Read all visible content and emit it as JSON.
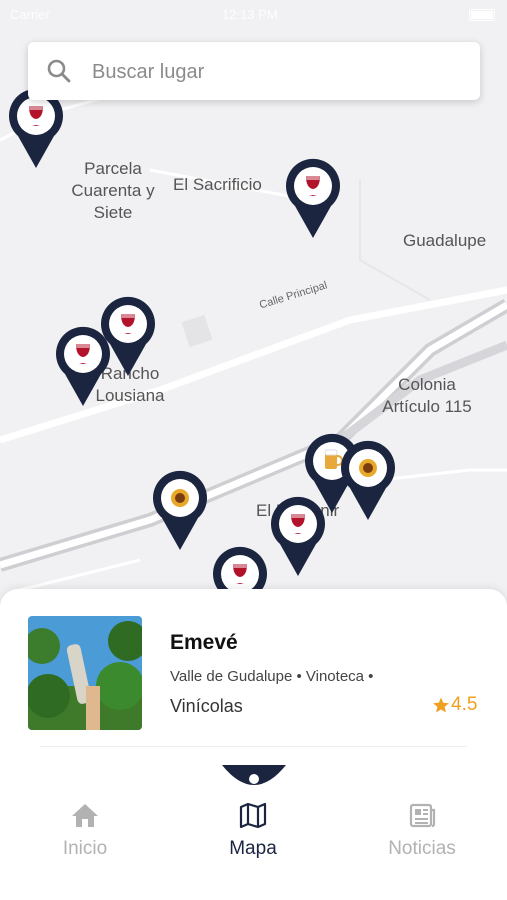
{
  "status_bar": {
    "carrier": "Carrier",
    "time": "12:13 PM"
  },
  "search": {
    "placeholder": "Buscar lugar"
  },
  "map": {
    "places": [
      {
        "name": "Parcela Cuarenta y Siete"
      },
      {
        "name": "El Sacrificio"
      },
      {
        "name": "Guadalupe"
      },
      {
        "name": "Rancho Lousiana"
      },
      {
        "name": "Colonia Artículo 115"
      },
      {
        "name": "El Porvenir"
      }
    ],
    "street": "Calle Principal",
    "pins": [
      {
        "icon": "wine-glass-icon"
      },
      {
        "icon": "wine-glass-icon"
      },
      {
        "icon": "wine-glass-icon"
      },
      {
        "icon": "wine-glass-icon"
      },
      {
        "icon": "beer-mug-icon"
      },
      {
        "icon": "food-plate-icon"
      },
      {
        "icon": "food-plate-icon"
      },
      {
        "icon": "wine-glass-icon"
      },
      {
        "icon": "wine-glass-icon"
      }
    ],
    "pin_color": "#1b2540",
    "wine_color": "#b3122b"
  },
  "card": {
    "title": "Emevé",
    "subtitle": "Valle de Gudalupe • Vinoteca •",
    "category": "Vinícolas",
    "rating": "4.5",
    "rating_color": "#f0a020"
  },
  "tabbar": {
    "tabs": [
      {
        "label": "Inicio",
        "icon": "home-icon"
      },
      {
        "label": "Mapa",
        "icon": "map-icon",
        "active": true
      },
      {
        "label": "Noticias",
        "icon": "newspaper-icon"
      }
    ]
  }
}
